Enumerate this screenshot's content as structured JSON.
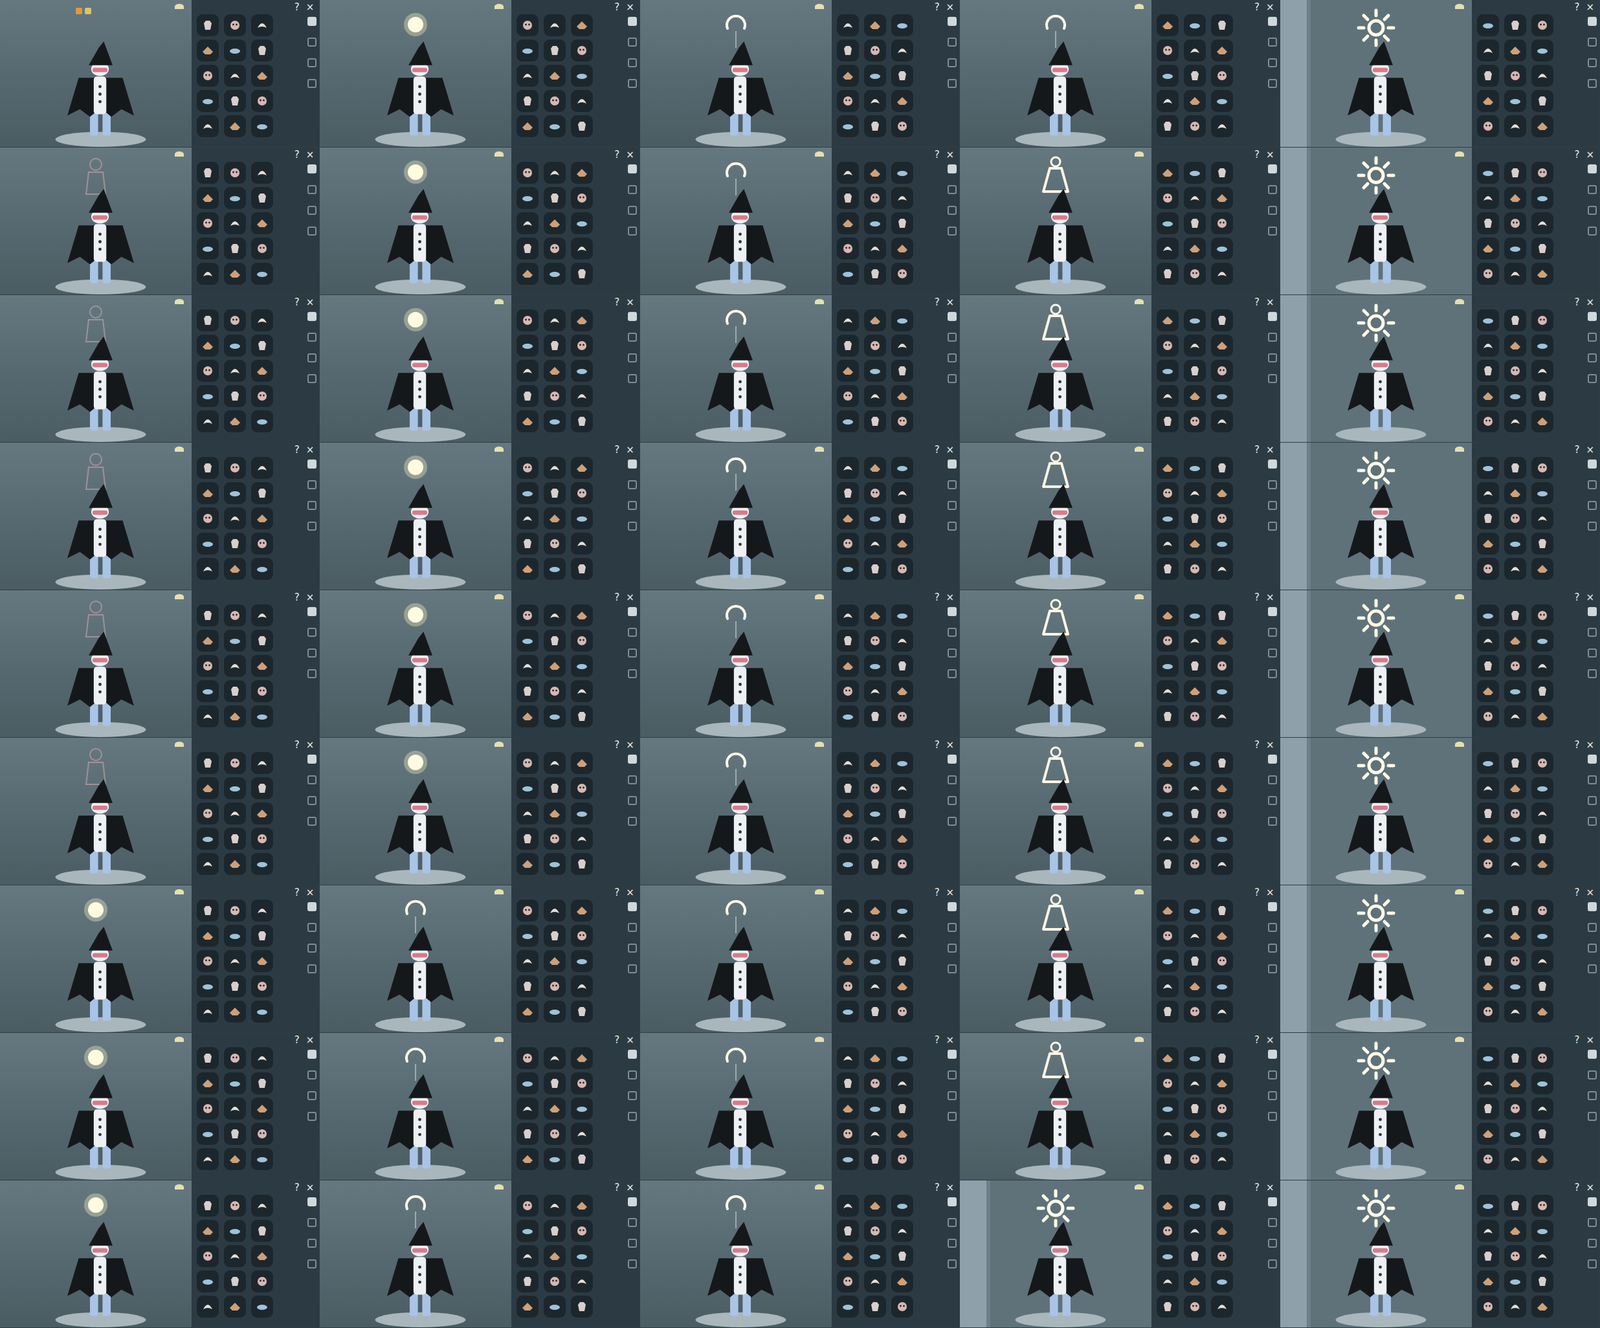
{
  "tiles": [
    {
      "kind": "none",
      "help": "?",
      "close": "×"
    },
    {
      "kind": "orb",
      "help": "?",
      "close": "×"
    },
    {
      "kind": "halo",
      "help": "?",
      "close": "×"
    },
    {
      "kind": "halo",
      "help": "?",
      "close": "×"
    },
    {
      "kind": "sun",
      "help": "?",
      "close": "×"
    },
    {
      "kind": "figure",
      "help": "?",
      "close": "×"
    },
    {
      "kind": "orb",
      "help": "?",
      "close": "×"
    },
    {
      "kind": "halo",
      "help": "?",
      "close": "×"
    },
    {
      "kind": "dress",
      "help": "?",
      "close": "×"
    },
    {
      "kind": "sun",
      "help": "?",
      "close": "×"
    },
    {
      "kind": "figure",
      "help": "?",
      "close": "×"
    },
    {
      "kind": "orb",
      "help": "?",
      "close": "×"
    },
    {
      "kind": "halo",
      "help": "?",
      "close": "×"
    },
    {
      "kind": "dress",
      "help": "?",
      "close": "×"
    },
    {
      "kind": "sun",
      "help": "?",
      "close": "×"
    },
    {
      "kind": "figure",
      "help": "?",
      "close": "×"
    },
    {
      "kind": "orb",
      "help": "?",
      "close": "×"
    },
    {
      "kind": "halo",
      "help": "?",
      "close": "×"
    },
    {
      "kind": "dress",
      "help": "?",
      "close": "×"
    },
    {
      "kind": "sun",
      "help": "?",
      "close": "×"
    },
    {
      "kind": "figure",
      "help": "?",
      "close": "×"
    },
    {
      "kind": "orb",
      "help": "?",
      "close": "×"
    },
    {
      "kind": "halo",
      "help": "?",
      "close": "×"
    },
    {
      "kind": "dress",
      "help": "?",
      "close": "×"
    },
    {
      "kind": "sun",
      "help": "?",
      "close": "×"
    },
    {
      "kind": "figure",
      "help": "?",
      "close": "×"
    },
    {
      "kind": "orb",
      "help": "?",
      "close": "×"
    },
    {
      "kind": "halo",
      "help": "?",
      "close": "×"
    },
    {
      "kind": "dress",
      "help": "?",
      "close": "×"
    },
    {
      "kind": "sun",
      "help": "?",
      "close": "×"
    },
    {
      "kind": "orb",
      "help": "?",
      "close": "×"
    },
    {
      "kind": "halo",
      "help": "?",
      "close": "×"
    },
    {
      "kind": "halo",
      "help": "?",
      "close": "×"
    },
    {
      "kind": "dress",
      "help": "?",
      "close": "×"
    },
    {
      "kind": "sun",
      "help": "?",
      "close": "×"
    },
    {
      "kind": "orb",
      "help": "?",
      "close": "×"
    },
    {
      "kind": "halo",
      "help": "?",
      "close": "×"
    },
    {
      "kind": "halo",
      "help": "?",
      "close": "×"
    },
    {
      "kind": "dress",
      "help": "?",
      "close": "×"
    },
    {
      "kind": "sun",
      "help": "?",
      "close": "×"
    },
    {
      "kind": "orb",
      "help": "?",
      "close": "×"
    },
    {
      "kind": "halo",
      "help": "?",
      "close": "×"
    },
    {
      "kind": "halo",
      "help": "?",
      "close": "×"
    },
    {
      "kind": "sun",
      "help": "?",
      "close": "×"
    },
    {
      "kind": "sun",
      "help": "?",
      "close": "×"
    }
  ]
}
